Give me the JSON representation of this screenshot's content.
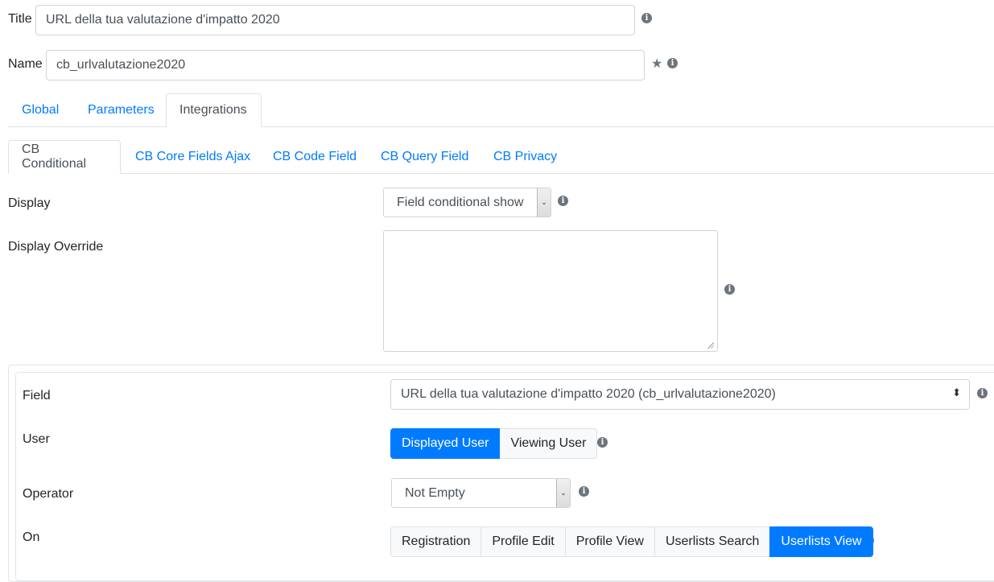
{
  "header": {
    "title_label": "Title",
    "title_value": "URL della tua valutazione d'impatto 2020",
    "name_label": "Name",
    "name_value": "cb_urlvalutazione2020"
  },
  "main_tabs": [
    {
      "label": "Global",
      "active": false
    },
    {
      "label": "Parameters",
      "active": false
    },
    {
      "label": "Integrations",
      "active": true
    }
  ],
  "sub_tabs": [
    {
      "label": "CB Conditional",
      "active": true
    },
    {
      "label": "CB Core Fields Ajax",
      "active": false
    },
    {
      "label": "CB Code Field",
      "active": false
    },
    {
      "label": "CB Query Field",
      "active": false
    },
    {
      "label": "CB Privacy",
      "active": false
    }
  ],
  "display": {
    "label": "Display",
    "selected": "Field conditional show"
  },
  "display_override": {
    "label": "Display Override",
    "value": ""
  },
  "condition": {
    "field_label": "Field",
    "field_selected": "URL della tua valutazione d'impatto 2020 (cb_urlvalutazione2020)",
    "user_label": "User",
    "user_options": [
      {
        "label": "Displayed User",
        "active": true
      },
      {
        "label": "Viewing User",
        "active": false
      }
    ],
    "operator_label": "Operator",
    "operator_selected": "Not Empty",
    "on_label": "On",
    "on_options": [
      {
        "label": "Registration",
        "active": false
      },
      {
        "label": "Profile Edit",
        "active": false
      },
      {
        "label": "Profile View",
        "active": false
      },
      {
        "label": "Userlists Search",
        "active": false
      },
      {
        "label": "Userlists View",
        "active": true
      }
    ]
  },
  "icons": {
    "info": "i",
    "star": "★",
    "chevron_down": "⌄",
    "sort_arrows": "⬍"
  },
  "colors": {
    "accent": "#007bff",
    "text": "#212529",
    "muted": "#6c757d",
    "border": "#ced4da"
  }
}
